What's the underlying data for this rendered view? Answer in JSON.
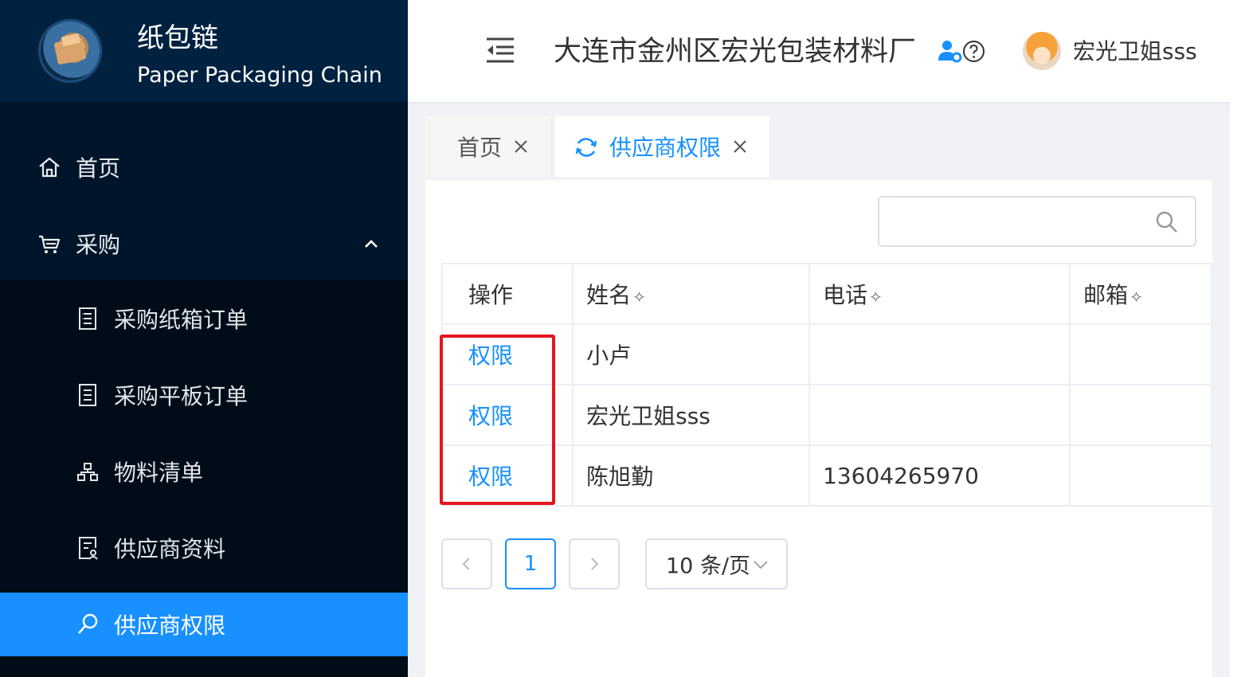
{
  "brand": {
    "title": "纸包链",
    "subtitle": "Paper Packaging Chain"
  },
  "sidebar": {
    "home": {
      "label": "首页",
      "icon": "home-icon"
    },
    "purchase": {
      "label": "采购",
      "icon": "cart-icon",
      "expanded": true
    },
    "sub_items": [
      {
        "label": "采购纸箱订单",
        "icon": "document-icon"
      },
      {
        "label": "采购平板订单",
        "icon": "document-icon"
      },
      {
        "label": "物料清单",
        "icon": "hierarchy-icon"
      },
      {
        "label": "供应商资料",
        "icon": "profile-document-icon"
      },
      {
        "label": "供应商权限",
        "icon": "key-search-icon",
        "active": true
      }
    ]
  },
  "header": {
    "company": "大连市金州区宏光包装材料厂",
    "username": "宏光卫姐sss"
  },
  "tabs": [
    {
      "label": "首页",
      "active": false
    },
    {
      "label": "供应商权限",
      "active": true
    }
  ],
  "search": {
    "value": "",
    "placeholder": ""
  },
  "table": {
    "headers": {
      "op": "操作",
      "name": "姓名",
      "phone": "电话",
      "email": "邮箱"
    },
    "sort_mark": "✧",
    "rows": [
      {
        "action": "权限",
        "name": "小卢",
        "phone": "",
        "email": ""
      },
      {
        "action": "权限",
        "name": "宏光卫姐sss",
        "phone": "",
        "email": ""
      },
      {
        "action": "权限",
        "name": "陈旭勤",
        "phone": "13604265970",
        "email": ""
      }
    ]
  },
  "pagination": {
    "prev": "<",
    "current_page": "1",
    "next": ">",
    "page_size_label": "10 条/页"
  },
  "colors": {
    "sidebar_bg": "#001529",
    "brand_bg": "#002140",
    "submenu_bg": "#000c17",
    "accent": "#1890ff",
    "highlight": "#e5161e"
  }
}
